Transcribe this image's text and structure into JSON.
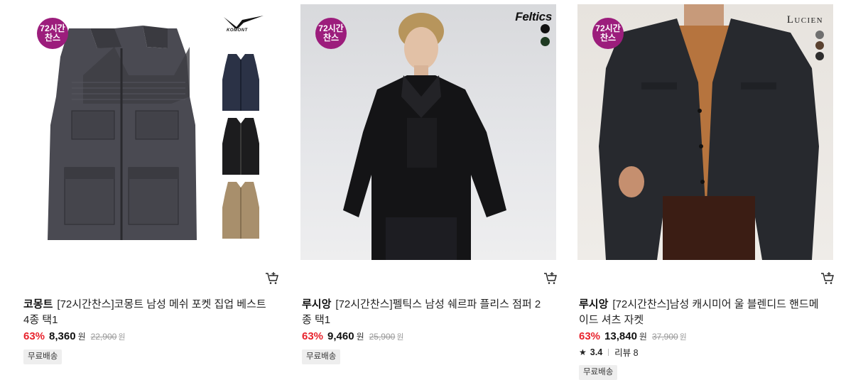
{
  "products": [
    {
      "badge_top": "72시간",
      "badge_bottom": "찬스",
      "logo": "KOMONT",
      "brand": "코몽트",
      "title_line1": "[72시간찬스]코몽트 남성 메쉬 포켓 집업 베스트",
      "title_line2": "4종 택1",
      "discount": "63%",
      "price": "8,360",
      "currency": "원",
      "original_price": "22,900",
      "shipping": "무료배송",
      "colors": [
        "#2b3246",
        "#1c1c1e",
        "#a88f6c"
      ]
    },
    {
      "badge_top": "72시간",
      "badge_bottom": "찬스",
      "logo": "Feltics",
      "brand": "루시앙",
      "title_line1": "[72시간찬스]펠틱스 남성 쉐르파 플리스 점퍼 2",
      "title_line2": "종 택1",
      "discount": "63%",
      "price": "9,460",
      "currency": "원",
      "original_price": "25,900",
      "shipping": "무료배송",
      "colors": [
        "#111111",
        "#1f3a22"
      ]
    },
    {
      "badge_top": "72시간",
      "badge_bottom": "찬스",
      "logo": "LUCIEN",
      "brand": "루시앙",
      "title_line1": "[72시간찬스]남성 캐시미어 울 블렌디드 핸드메",
      "title_line2": "이드 셔츠 자켓",
      "discount": "63%",
      "price": "13,840",
      "currency": "원",
      "original_price": "37,900",
      "rating": "3.4",
      "review_label": "리뷰 8",
      "shipping": "무료배송",
      "colors": [
        "#6f6f6f",
        "#5a4130",
        "#2d2d2d"
      ]
    }
  ],
  "icons": {
    "cart": "cart-add-icon",
    "star": "star-icon"
  }
}
